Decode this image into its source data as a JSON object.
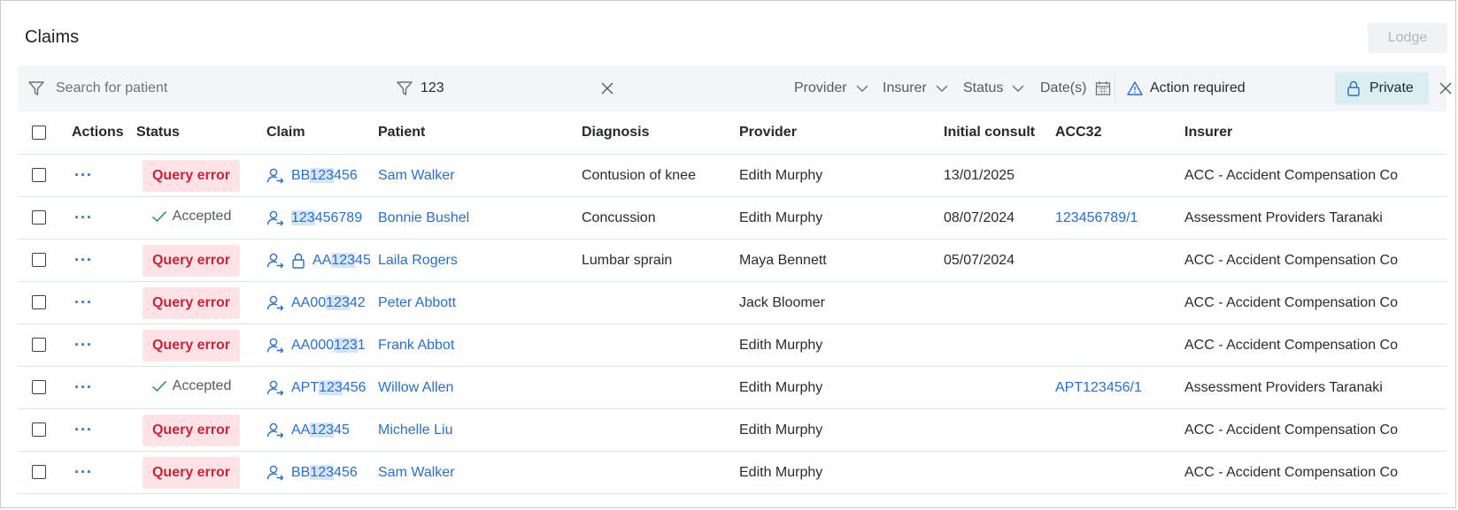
{
  "page": {
    "title": "Claims",
    "lodge_label": "Lodge"
  },
  "filters": {
    "search_placeholder": "Search for patient",
    "claim_filter_value": "123",
    "provider_label": "Provider",
    "insurer_label": "Insurer",
    "status_label": "Status",
    "dates_label": "Date(s)",
    "action_required_label": "Action required",
    "private_label": "Private"
  },
  "table": {
    "headers": {
      "actions": "Actions",
      "status": "Status",
      "claim": "Claim",
      "patient": "Patient",
      "diagnosis": "Diagnosis",
      "provider": "Provider",
      "initial_consult": "Initial consult",
      "acc32": "ACC32",
      "insurer": "Insurer"
    },
    "row_action_glyph": "···",
    "rows": [
      {
        "status": "Query error",
        "status_type": "error",
        "claim_pre": "BB",
        "claim_hl": "123",
        "claim_post": "456",
        "private": false,
        "patient": "Sam Walker",
        "diagnosis": "Contusion of knee",
        "provider": "Edith Murphy",
        "initial_consult": "13/01/2025",
        "acc32": "",
        "insurer": "ACC - Accident Compensation Co"
      },
      {
        "status": "Accepted",
        "status_type": "accepted",
        "claim_pre": "",
        "claim_hl": "123",
        "claim_post": "456789",
        "private": false,
        "patient": "Bonnie Bushel",
        "diagnosis": "Concussion",
        "provider": "Edith Murphy",
        "initial_consult": "08/07/2024",
        "acc32": "123456789/1",
        "insurer": "Assessment Providers Taranaki"
      },
      {
        "status": "Query error",
        "status_type": "error",
        "claim_pre": "AA",
        "claim_hl": "123",
        "claim_post": "45",
        "private": true,
        "patient": "Laila Rogers",
        "diagnosis": "Lumbar sprain",
        "provider": "Maya Bennett",
        "initial_consult": "05/07/2024",
        "acc32": "",
        "insurer": "ACC - Accident Compensation Co"
      },
      {
        "status": "Query error",
        "status_type": "error",
        "claim_pre": "AA00",
        "claim_hl": "123",
        "claim_post": "42",
        "private": false,
        "patient": "Peter Abbott",
        "diagnosis": "",
        "provider": "Jack Bloomer",
        "initial_consult": "",
        "acc32": "",
        "insurer": "ACC - Accident Compensation Co"
      },
      {
        "status": "Query error",
        "status_type": "error",
        "claim_pre": "AA000",
        "claim_hl": "123",
        "claim_post": "1",
        "private": false,
        "patient": "Frank Abbot",
        "diagnosis": "",
        "provider": "Edith Murphy",
        "initial_consult": "",
        "acc32": "",
        "insurer": "ACC - Accident Compensation Co"
      },
      {
        "status": "Accepted",
        "status_type": "accepted",
        "claim_pre": "APT",
        "claim_hl": "123",
        "claim_post": "456",
        "private": false,
        "patient": "Willow Allen",
        "diagnosis": "",
        "provider": "Edith Murphy",
        "initial_consult": "",
        "acc32": "APT123456/1",
        "insurer": "Assessment Providers Taranaki"
      },
      {
        "status": "Query error",
        "status_type": "error",
        "claim_pre": "AA",
        "claim_hl": "123",
        "claim_post": "45",
        "private": false,
        "patient": "Michelle Liu",
        "diagnosis": "",
        "provider": "Edith Murphy",
        "initial_consult": "",
        "acc32": "",
        "insurer": "ACC - Accident Compensation Co"
      },
      {
        "status": "Query error",
        "status_type": "error",
        "claim_pre": "BB",
        "claim_hl": "123",
        "claim_post": "456",
        "private": false,
        "patient": "Sam Walker",
        "diagnosis": "",
        "provider": "Edith Murphy",
        "initial_consult": "",
        "acc32": "",
        "insurer": "ACC - Accident Compensation Co"
      }
    ]
  },
  "colors": {
    "link": "#2a6fc9",
    "error_bg": "#fde3e5",
    "error_text": "#c6253a",
    "private_chip": "#d8eef0"
  },
  "icons": [
    "funnel-icon",
    "close-icon",
    "chevron-down-icon",
    "calendar-icon",
    "warning-triangle-icon",
    "lock-icon",
    "person-arrow-icon",
    "check-icon"
  ]
}
